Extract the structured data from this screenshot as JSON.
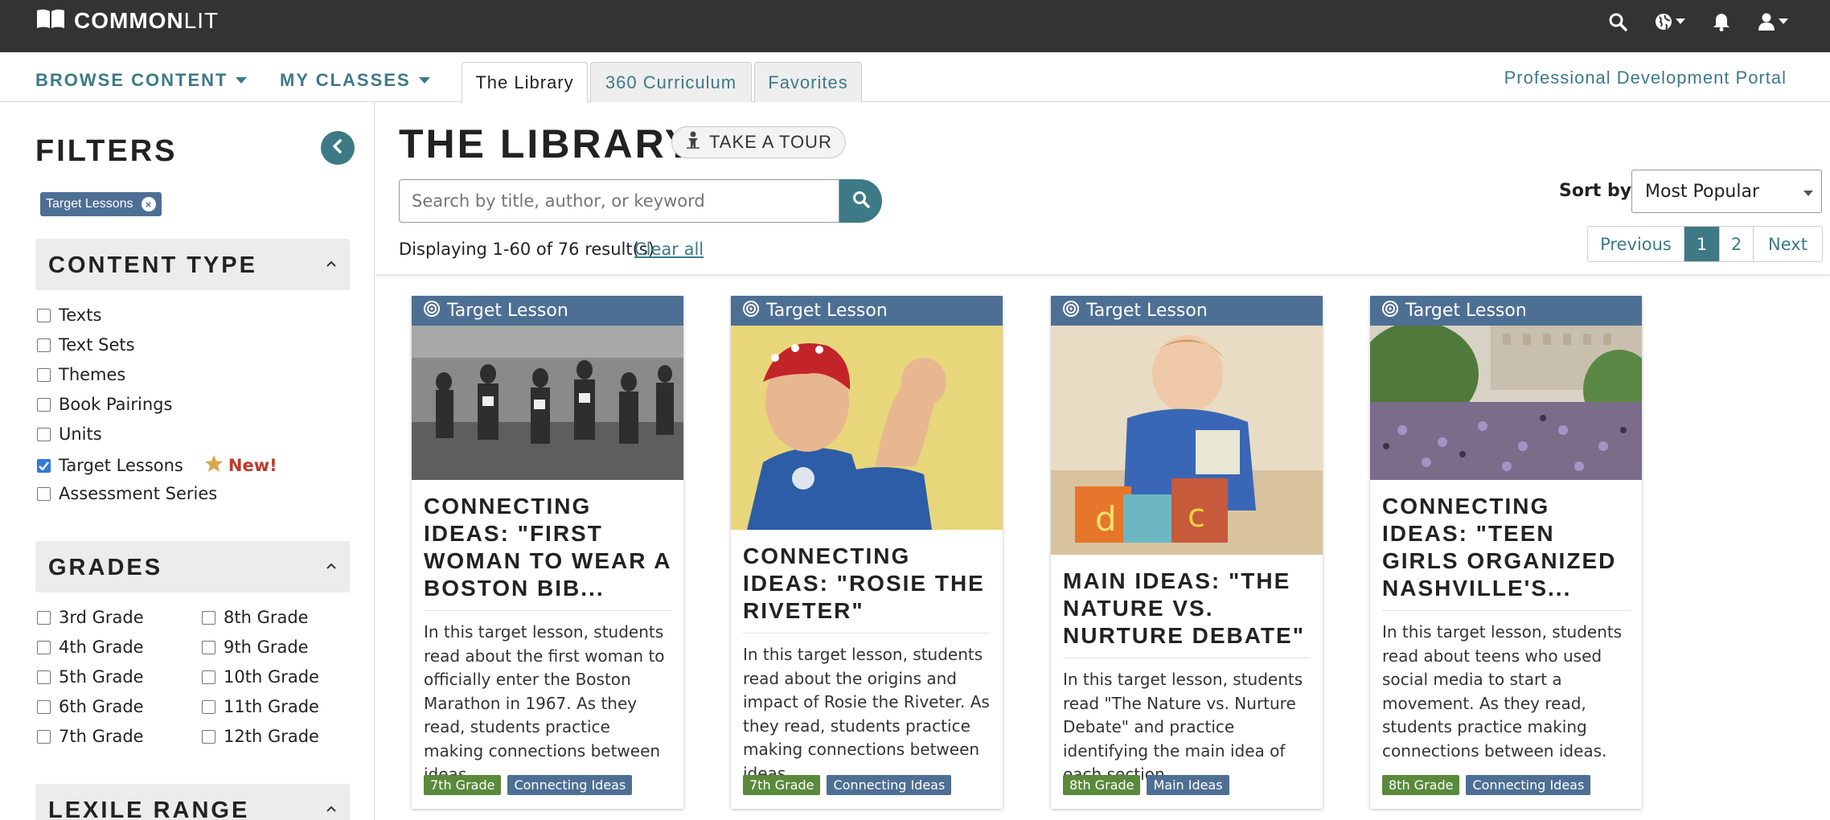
{
  "header": {
    "logo_common": "COMMON",
    "logo_lit": "LIT"
  },
  "nav": {
    "browse_content": "BROWSE CONTENT",
    "my_classes": "MY CLASSES",
    "tabs": [
      {
        "label": "The Library",
        "active": true
      },
      {
        "label": "360 Curriculum",
        "active": false
      },
      {
        "label": "Favorites",
        "active": false
      }
    ],
    "pd_portal": "Professional Development Portal"
  },
  "sidebar": {
    "title": "FILTERS",
    "active_chip": "Target Lessons",
    "content_type": {
      "title": "CONTENT TYPE",
      "items": [
        {
          "label": "Texts",
          "checked": false
        },
        {
          "label": "Text Sets",
          "checked": false
        },
        {
          "label": "Themes",
          "checked": false
        },
        {
          "label": "Book Pairings",
          "checked": false
        },
        {
          "label": "Units",
          "checked": false
        },
        {
          "label": "Target Lessons",
          "checked": true
        },
        {
          "label": "Assessment Series",
          "checked": false
        }
      ],
      "new_label": "New!"
    },
    "grades": {
      "title": "GRADES",
      "col1": [
        "3rd Grade",
        "4th Grade",
        "5th Grade",
        "6th Grade",
        "7th Grade"
      ],
      "col2": [
        "8th Grade",
        "9th Grade",
        "10th Grade",
        "11th Grade",
        "12th Grade"
      ]
    },
    "lexile": {
      "title": "LEXILE RANGE"
    }
  },
  "main": {
    "title": "THE LIBRARY",
    "tour_label": "TAKE A TOUR",
    "search_placeholder": "Search by title, author, or keyword",
    "sort_label": "Sort by",
    "sort_value": "Most Popular",
    "results_text": "Displaying 1-60 of 76 result(s)",
    "clear_all": "Clear all",
    "pager": {
      "previous": "Previous",
      "page1": "1",
      "page2": "2",
      "next": "Next"
    }
  },
  "cards": [
    {
      "type": "Target Lesson",
      "title": "CONNECTING IDEAS: \"FIRST WOMAN TO WEAR A BOSTON BIB...",
      "description": "In this target lesson, students read about the first woman to officially enter the Boston Marathon in 1967. As they read, students practice making connections between ideas.",
      "grade": "7th Grade",
      "skill": "Connecting Ideas"
    },
    {
      "type": "Target Lesson",
      "title": "CONNECTING IDEAS: \"ROSIE THE RIVETER\"",
      "description": "In this target lesson, students read about the origins and impact of Rosie the Riveter. As they read, students practice making connections between ideas.",
      "grade": "7th Grade",
      "skill": "Connecting Ideas"
    },
    {
      "type": "Target Lesson",
      "title": "MAIN IDEAS: \"THE NATURE VS. NURTURE DEBATE\"",
      "description": "In this target lesson, students read \"The Nature vs. Nurture Debate\" and practice identifying the main idea of each section.",
      "grade": "8th Grade",
      "skill": "Main Ideas"
    },
    {
      "type": "Target Lesson",
      "title": "CONNECTING IDEAS: \"TEEN GIRLS ORGANIZED NASHVILLE'S...",
      "description": "In this target lesson, students read about teens who used social media to start a movement. As they read, students practice making connections between ideas.",
      "grade": "8th Grade",
      "skill": "Connecting Ideas"
    }
  ],
  "colors": {
    "teal": "#3d7a86",
    "card_header": "#4e6f94",
    "grade_tag": "#5a8a3c",
    "topbar": "#333333"
  }
}
